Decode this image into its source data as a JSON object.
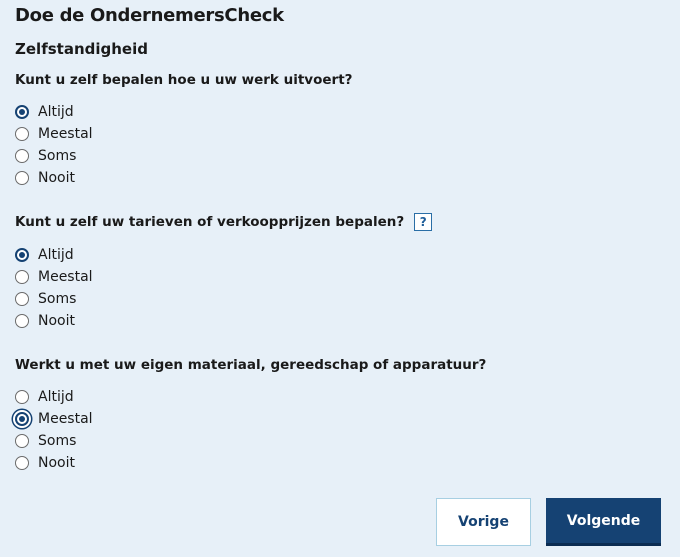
{
  "page": {
    "title": "Doe de OndernemersCheck",
    "section_title": "Zelfstandigheid"
  },
  "questions": [
    {
      "text": "Kunt u zelf bepalen hoe u uw werk uitvoert?",
      "has_help": false,
      "options": [
        "Altijd",
        "Meestal",
        "Soms",
        "Nooit"
      ],
      "selected": "Altijd"
    },
    {
      "text": "Kunt u zelf uw tarieven of verkoopprijzen bepalen?",
      "has_help": true,
      "help_label": "?",
      "options": [
        "Altijd",
        "Meestal",
        "Soms",
        "Nooit"
      ],
      "selected": "Altijd"
    },
    {
      "text": "Werkt u met uw eigen materiaal, gereedschap of apparatuur?",
      "has_help": false,
      "options": [
        "Altijd",
        "Meestal",
        "Soms",
        "Nooit"
      ],
      "selected": "Meestal",
      "focused": "Meestal"
    }
  ],
  "buttons": {
    "prev_label": "Vorige",
    "next_label": "Volgende"
  },
  "colors": {
    "background": "#e7f0f8",
    "primary": "#154273",
    "button_border": "#a7cfe2"
  }
}
